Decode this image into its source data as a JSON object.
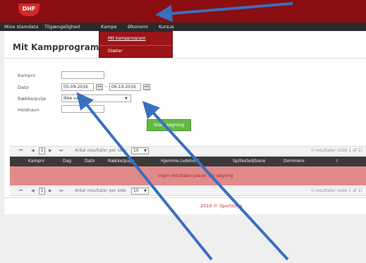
{
  "header": {
    "logo_text": "DHF"
  },
  "nav": {
    "items": [
      {
        "label": "Mine stamdata"
      },
      {
        "label": "Tilgængelighed"
      },
      {
        "label": "Kampe"
      },
      {
        "label": "Økonomi"
      },
      {
        "label": "Kursus"
      }
    ]
  },
  "dropdown": {
    "items": [
      {
        "label": "Mit kampprogram"
      },
      {
        "label": "Diæter"
      }
    ]
  },
  "page": {
    "title": "Mit Kampprogram"
  },
  "form": {
    "kampnr_label": "Kampnr.",
    "kampnr_value": "",
    "dato_label": "Dato",
    "date_from": "05-09-2016",
    "date_separator": "-",
    "date_to": "06-10-2016",
    "raekke_label": "Række/pulje",
    "raekke_value": "Ikke valgt",
    "holdnavn_label": "Holdnavn",
    "holdnavn_value": "",
    "search_button": "Start søgning"
  },
  "pager": {
    "first": "⏮",
    "prev": "◀",
    "page": "1",
    "next": "▶",
    "last": "⏭",
    "per_page_label": "Antal resultater per side",
    "per_page_value": "10",
    "results_text": "0 resultater (side 1 af 1)"
  },
  "table": {
    "columns": [
      "Kampnr",
      "Dag",
      "Dato",
      "Række/pulje",
      "Hjemme-/udehold",
      "Spillested/bane",
      "Dommere",
      "I"
    ],
    "empty_message": "Ingen resultater passer din søgning"
  },
  "footer": {
    "text": "2010 © SportsSys"
  },
  "colors": {
    "header_bg": "#8a0e12",
    "nav_bg": "#2b2b2b",
    "search_button": "#62b845",
    "arrow": "#3a6fc0"
  }
}
